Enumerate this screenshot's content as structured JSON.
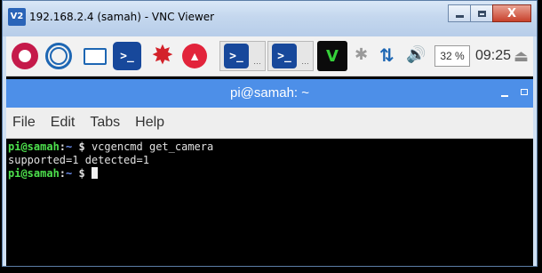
{
  "vnc_window": {
    "icon_text": "V2",
    "title": "192.168.2.4 (samah) - VNC Viewer",
    "close_label": "X"
  },
  "panel": {
    "launchers": [
      {
        "name": "raspberry-menu-icon"
      },
      {
        "name": "web-browser-icon"
      },
      {
        "name": "file-manager-icon"
      },
      {
        "name": "terminal-icon"
      },
      {
        "name": "wolfram-icon"
      },
      {
        "name": "mathematica-icon"
      }
    ],
    "taskbar_items": [
      {
        "name": "terminal-task-1"
      },
      {
        "name": "terminal-task-2"
      }
    ],
    "vnc_tray_label": "V",
    "tray": {
      "bluetooth_icon": "bluetooth-icon",
      "network_icon": "network-icon",
      "volume_icon": "volume-icon",
      "cpu_percent": "32 %",
      "clock": "09:25",
      "eject_icon": "eject-icon"
    }
  },
  "terminal": {
    "title": "pi@samah: ~",
    "menu": [
      "File",
      "Edit",
      "Tabs",
      "Help"
    ],
    "lines": [
      {
        "user": "pi@samah",
        "sep": ":",
        "path": "~",
        "dollar": " $",
        "command": " vcgencmd get_camera"
      },
      {
        "output": "supported=1 detected=1"
      },
      {
        "user": "pi@samah",
        "sep": ":",
        "path": "~",
        "dollar": " $",
        "command": " "
      }
    ]
  },
  "colors": {
    "terminal_title_bg": "#4d8fe8",
    "prompt_user": "#4de04d",
    "prompt_path": "#6c8ff0"
  }
}
